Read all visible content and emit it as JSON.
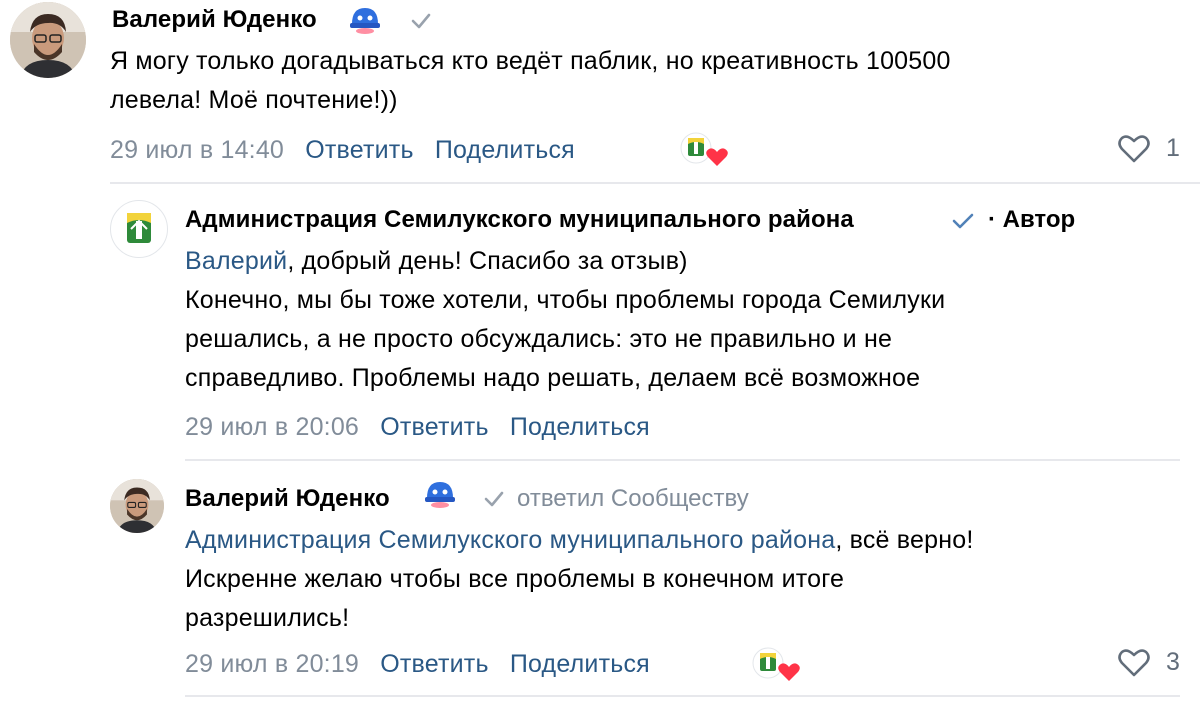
{
  "comments": [
    {
      "author": "Валерий Юденко",
      "lines": [
        "Я могу только догадываться кто ведёт паблик, но креативность 100500",
        "левела! Моё почтение!))"
      ],
      "date": "29 июл в 14:40",
      "reply_label": "Ответить",
      "share_label": "Поделиться",
      "likes": "1"
    },
    {
      "author": "Администрация Семилукского муниципального района",
      "role": "· Автор",
      "mention": "Валерий",
      "first_line_rest": ", добрый день! Спасибо за отзыв)",
      "lines": [
        "Конечно, мы бы тоже хотели, чтобы проблемы города Семилуки",
        "решались, а не просто обсуждались: это не правильно и не",
        "справедливо. Проблемы надо решать, делаем всё возможное"
      ],
      "date": "29 июл в 20:06",
      "reply_label": "Ответить",
      "share_label": "Поделиться"
    },
    {
      "author": "Валерий Юденко",
      "replied_to": "ответил Сообществу",
      "mention": "Администрация Семилукского муниципального района",
      "first_line_rest": ", всё верно!",
      "lines": [
        "Искренне желаю чтобы все проблемы в конечном итоге",
        "разрешились!"
      ],
      "date": "29 июл в 20:19",
      "reply_label": "Ответить",
      "share_label": "Поделиться",
      "likes": "3"
    }
  ],
  "colors": {
    "link": "#2a5885",
    "meta": "#818c99",
    "divider": "#e7e8ec",
    "verified": "#99a2ad",
    "heart": "#ff3347"
  },
  "icons": [
    "avatar-photo",
    "helmet-badge-icon",
    "check-icon",
    "verified-icon",
    "group-logo",
    "heart-reaction-icon",
    "like-heart-icon"
  ]
}
